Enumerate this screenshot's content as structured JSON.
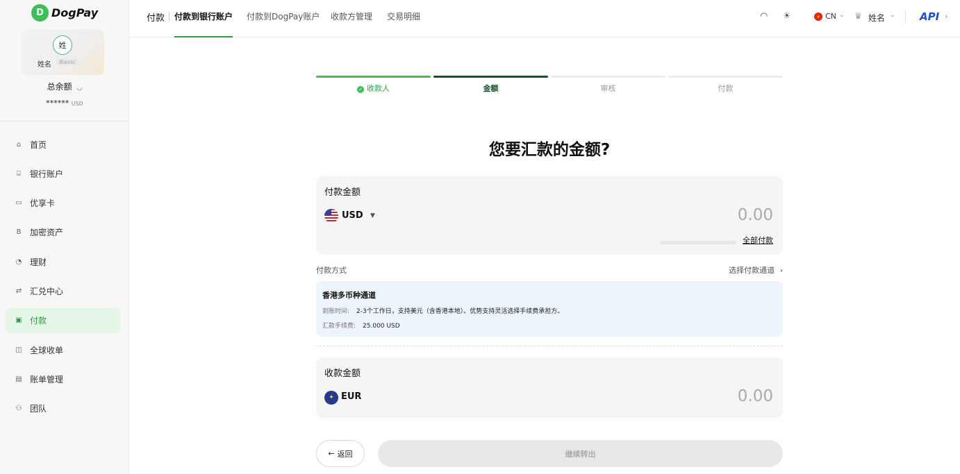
{
  "brand": {
    "logo_text": "DogPay",
    "accent": "#2e9a47"
  },
  "profile": {
    "avatar_text": "姓",
    "name": "姓名",
    "tier": "Basic",
    "balance_label": "总余额",
    "balance_value": "******",
    "balance_unit": "USD"
  },
  "sidebar": {
    "items": [
      {
        "label": "首页",
        "icon": "home-icon",
        "glyph": "⌂"
      },
      {
        "label": "银行账户",
        "icon": "bank-icon",
        "glyph": "⌸"
      },
      {
        "label": "优享卡",
        "icon": "card-icon",
        "glyph": "▭"
      },
      {
        "label": "加密资产",
        "icon": "bitcoin-icon",
        "glyph": "B"
      },
      {
        "label": "理财",
        "icon": "chart-icon",
        "glyph": "◔"
      },
      {
        "label": "汇兑中心",
        "icon": "exchange-icon",
        "glyph": "⇄"
      },
      {
        "label": "付款",
        "icon": "payment-icon",
        "glyph": "▣"
      },
      {
        "label": "全球收单",
        "icon": "acquiring-icon",
        "glyph": "◫"
      },
      {
        "label": "账单管理",
        "icon": "bill-icon",
        "glyph": "▤"
      },
      {
        "label": "团队",
        "icon": "team-icon",
        "glyph": "⚇"
      }
    ]
  },
  "header": {
    "title": "付款",
    "tabs": [
      "付款到银行账户",
      "付款到DogPay账户",
      "收款方管理",
      "交易明细"
    ],
    "lang": "CN",
    "user": "姓名",
    "api": "API"
  },
  "steps": [
    "收款人",
    "金额",
    "审核",
    "付款"
  ],
  "page": {
    "heading": "您要汇款的金额?",
    "pay": {
      "title": "付款金额",
      "currency": "USD",
      "amount": "0.00",
      "pay_all": "全部付款"
    },
    "method_label": "付款方式",
    "method_link": "选择付款通道",
    "channel": {
      "name": "香港多币种通道",
      "arrival_key": "到账时间:",
      "arrival_value": "2-3个工作日，支持美元（含香港本地）。优势支持灵活选择手续费承担方。",
      "fee_key": "汇款手续费:",
      "fee_value": "25.000 USD"
    },
    "receive": {
      "title": "收款金额",
      "currency": "EUR",
      "amount": "0.00"
    },
    "back_label": "返回",
    "next_label": "继续转出"
  }
}
